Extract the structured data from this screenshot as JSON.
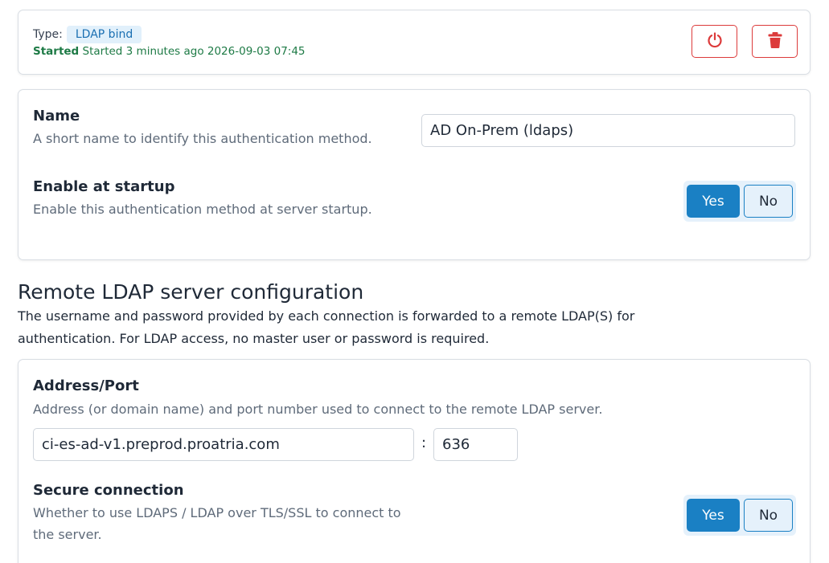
{
  "status": {
    "type_label": "Type:",
    "type_value": "LDAP bind",
    "state": "Started",
    "state_detail": "Started 3 minutes ago 2026-09-03 07:45",
    "power_icon": "power-icon",
    "delete_icon": "trash-icon"
  },
  "general": {
    "name": {
      "title": "Name",
      "description": "A short name to identify this authentication method.",
      "value": "AD On-Prem (ldaps)"
    },
    "startup": {
      "title": "Enable at startup",
      "description": "Enable this authentication method at server startup.",
      "yes_label": "Yes",
      "no_label": "No",
      "selected": "Yes"
    }
  },
  "remote": {
    "title": "Remote LDAP server configuration",
    "description": "The username and password provided by each connection is forwarded to a remote LDAP(S) for authentication. For LDAP access, no master user or password is required.",
    "address": {
      "title": "Address/Port",
      "description": "Address (or domain name) and port number used to connect to the remote LDAP server.",
      "host": "ci-es-ad-v1.preprod.proatria.com",
      "separator": ":",
      "port": "636"
    },
    "secure": {
      "title": "Secure connection",
      "description": "Whether to use LDAPS / LDAP over TLS/SSL to connect to the server.",
      "yes_label": "Yes",
      "no_label": "No",
      "selected": "Yes"
    }
  },
  "colors": {
    "accent": "#1a80c4",
    "danger": "#dc3b3b",
    "success": "#1d7a45",
    "badge_bg": "#e1f0fb"
  }
}
